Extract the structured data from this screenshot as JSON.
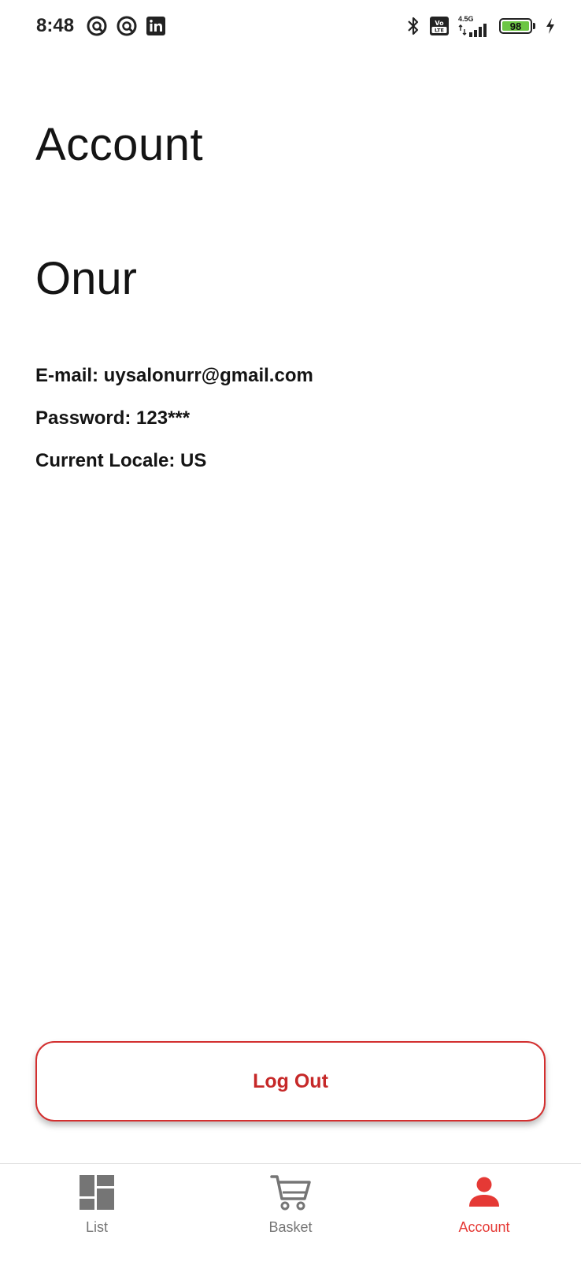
{
  "status_bar": {
    "time": "8:48",
    "network": "4.5G",
    "battery": "98"
  },
  "page": {
    "title": "Account",
    "user_name": "Onur"
  },
  "info": {
    "email": "E-mail: uysalonurr@gmail.com",
    "password": "Password: 123***",
    "locale": "Current Locale: US"
  },
  "actions": {
    "logout_label": "Log Out"
  },
  "bottom_nav": {
    "items": [
      {
        "label": "List",
        "icon": "dashboard-icon",
        "active": false
      },
      {
        "label": "Basket",
        "icon": "cart-icon",
        "active": false
      },
      {
        "label": "Account",
        "icon": "person-icon",
        "active": true
      }
    ]
  },
  "colors": {
    "accent": "#e53935",
    "logout_red": "#c62828",
    "inactive_icon": "#757575",
    "battery_fill": "#6cc644"
  }
}
